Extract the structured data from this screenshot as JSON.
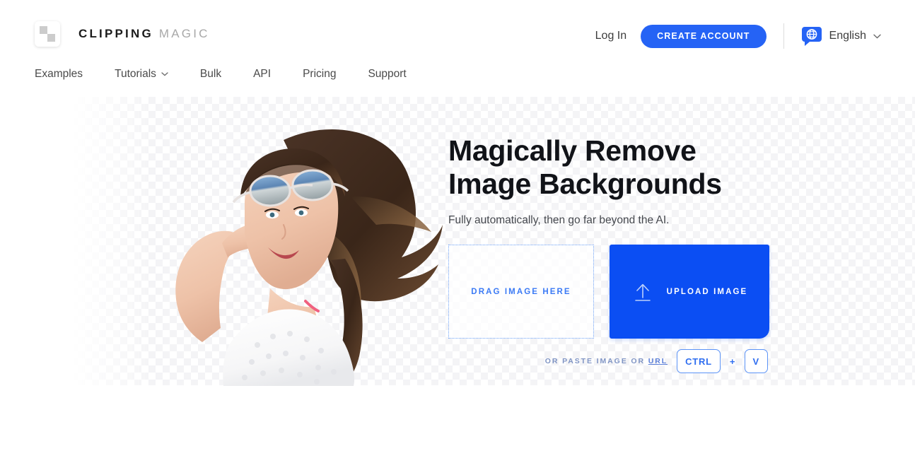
{
  "brand": {
    "word1": "CLIPPING",
    "word2": "MAGIC",
    "logo_icon": "checkerboard-logo-icon"
  },
  "header": {
    "login_label": "Log In",
    "create_account_label": "CREATE ACCOUNT",
    "language_label": "English",
    "language_icon": "globe-speech-bubble-icon",
    "language_chevron_icon": "chevron-down-icon"
  },
  "nav": {
    "items": [
      {
        "label": "Examples",
        "has_chevron": false
      },
      {
        "label": "Tutorials",
        "has_chevron": true
      },
      {
        "label": "Bulk",
        "has_chevron": false
      },
      {
        "label": "API",
        "has_chevron": false
      },
      {
        "label": "Pricing",
        "has_chevron": false
      },
      {
        "label": "Support",
        "has_chevron": false
      }
    ]
  },
  "hero": {
    "headline_line1": "Magically Remove",
    "headline_line2": "Image Backgrounds",
    "subhead": "Fully automatically, then go far beyond the AI.",
    "photo_alt": "smiling-woman-with-sunglasses-cutout"
  },
  "upload": {
    "dropzone_label": "DRAG IMAGE HERE",
    "upload_button_label": "UPLOAD IMAGE",
    "upload_icon": "upload-arrow-icon"
  },
  "paste": {
    "prefix": "OR PASTE IMAGE OR ",
    "url_label": "URL",
    "key_ctrl": "CTRL",
    "key_plus": "+",
    "key_v": "V"
  },
  "colors": {
    "accent_blue": "#2563f5",
    "upload_blue": "#0b4ef3",
    "link_blue": "#3b7af5",
    "paste_text": "#7f94c4",
    "text_dark": "#111318",
    "text_body": "#44474d",
    "nav_text": "#4a4a4a",
    "checker_light": "#ffffff",
    "checker_dark": "#f3f3f5"
  }
}
